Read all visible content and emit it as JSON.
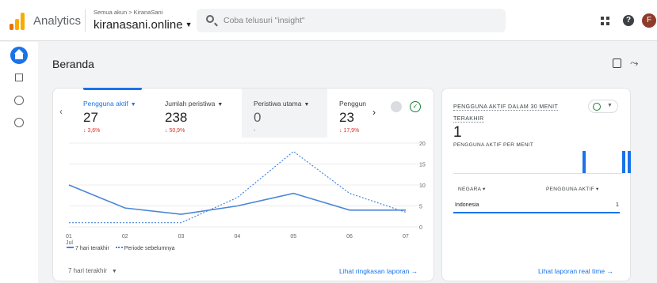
{
  "header": {
    "app_name": "Analytics",
    "breadcrumb": "Semua akun > KiranaSani",
    "property": "kiranasani.online",
    "search_placeholder": "Coba telusuri \"insight\"",
    "help_symbol": "?",
    "avatar_letter": "F"
  },
  "rail": {
    "items": [
      "home-icon",
      "reports-icon",
      "explore-icon",
      "advertising-icon"
    ]
  },
  "page": {
    "title": "Beranda"
  },
  "metrics": [
    {
      "label": "Pengguna aktif",
      "value": "27",
      "change": "↓ 3,6%",
      "active": true
    },
    {
      "label": "Jumlah peristiwa",
      "value": "238",
      "change": "↓ 50,9%",
      "active": false
    },
    {
      "label": "Peristiwa utama",
      "value": "0",
      "change": "-",
      "active": false
    },
    {
      "label": "Penggun",
      "value": "23",
      "change": "↓ 17,9%",
      "active": false
    }
  ],
  "chart_data": {
    "type": "line",
    "x": [
      "01 Jul",
      "02",
      "03",
      "04",
      "05",
      "06",
      "07"
    ],
    "x_tick_labels": [
      "01",
      "02",
      "03",
      "04",
      "05",
      "06",
      "07"
    ],
    "x_tick_sublabel": "Jul",
    "ylim": [
      0,
      20
    ],
    "y_ticks": [
      "0",
      "5",
      "10",
      "15",
      "20"
    ],
    "series": [
      {
        "name": "7 hari terakhir",
        "values": [
          10,
          4.5,
          3,
          5,
          8,
          4,
          4
        ],
        "style": "solid",
        "color": "#4a86d8"
      },
      {
        "name": "Periode sebelumnya",
        "values": [
          1,
          1,
          1,
          7,
          18,
          8,
          3.5
        ],
        "style": "dotted",
        "color": "#4a86d8"
      }
    ]
  },
  "legend": {
    "current": "7 hari terakhir",
    "previous": "Periode sebelumnya"
  },
  "range_selector": "7 hari terakhir",
  "main_link": "Lihat ringkasan laporan →",
  "realtime": {
    "title": "PENGGUNA AKTIF DALAM 30 MENIT TERAKHIR",
    "value": "1",
    "subtitle": "PENGGUNA AKTIF PER MENIT",
    "bars": [
      {
        "minute_index": 20,
        "value": 1
      },
      {
        "minute_index": 27,
        "value": 1
      },
      {
        "minute_index": 28,
        "value": 1
      }
    ],
    "col_country": "NEGARA ▾",
    "col_users": "PENGGUNA AKTIF ▾",
    "rows": [
      {
        "country": "Indonesia",
        "users": "1"
      }
    ],
    "link": "Lihat laporan real time →"
  },
  "colors": {
    "accent": "#1a73e8",
    "negative": "#d93025",
    "positive": "#188038",
    "logo_orange": "#f9ab00"
  }
}
